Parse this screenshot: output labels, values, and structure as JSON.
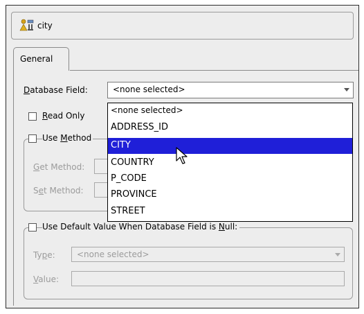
{
  "header": {
    "title": "city",
    "icon": "attribute-mapping-icon"
  },
  "tabs": [
    {
      "label": "General"
    }
  ],
  "form": {
    "database_field_label": "Database Field:",
    "database_field_value": "<none selected>",
    "read_only_label": "Read Only",
    "read_only_checked": false,
    "use_method_label": "Use Method",
    "use_method_checked": false,
    "get_method_label": "Get Method:",
    "set_method_label": "Set Method:",
    "use_default_label": "Use Default Value When Database Field is Null:",
    "use_default_checked": false,
    "type_label": "Type:",
    "type_value": "<none selected>",
    "value_label": "Value:",
    "value_text": ""
  },
  "dropdown": {
    "items": [
      {
        "label": "<none selected>"
      },
      {
        "label": "ADDRESS_ID"
      },
      {
        "label": "CITY"
      },
      {
        "label": "COUNTRY"
      },
      {
        "label": "P_CODE"
      },
      {
        "label": "PROVINCE"
      },
      {
        "label": "STREET"
      }
    ],
    "selected": "CITY"
  },
  "colors": {
    "selection": "#1f1fd8",
    "background": "#ededed"
  }
}
